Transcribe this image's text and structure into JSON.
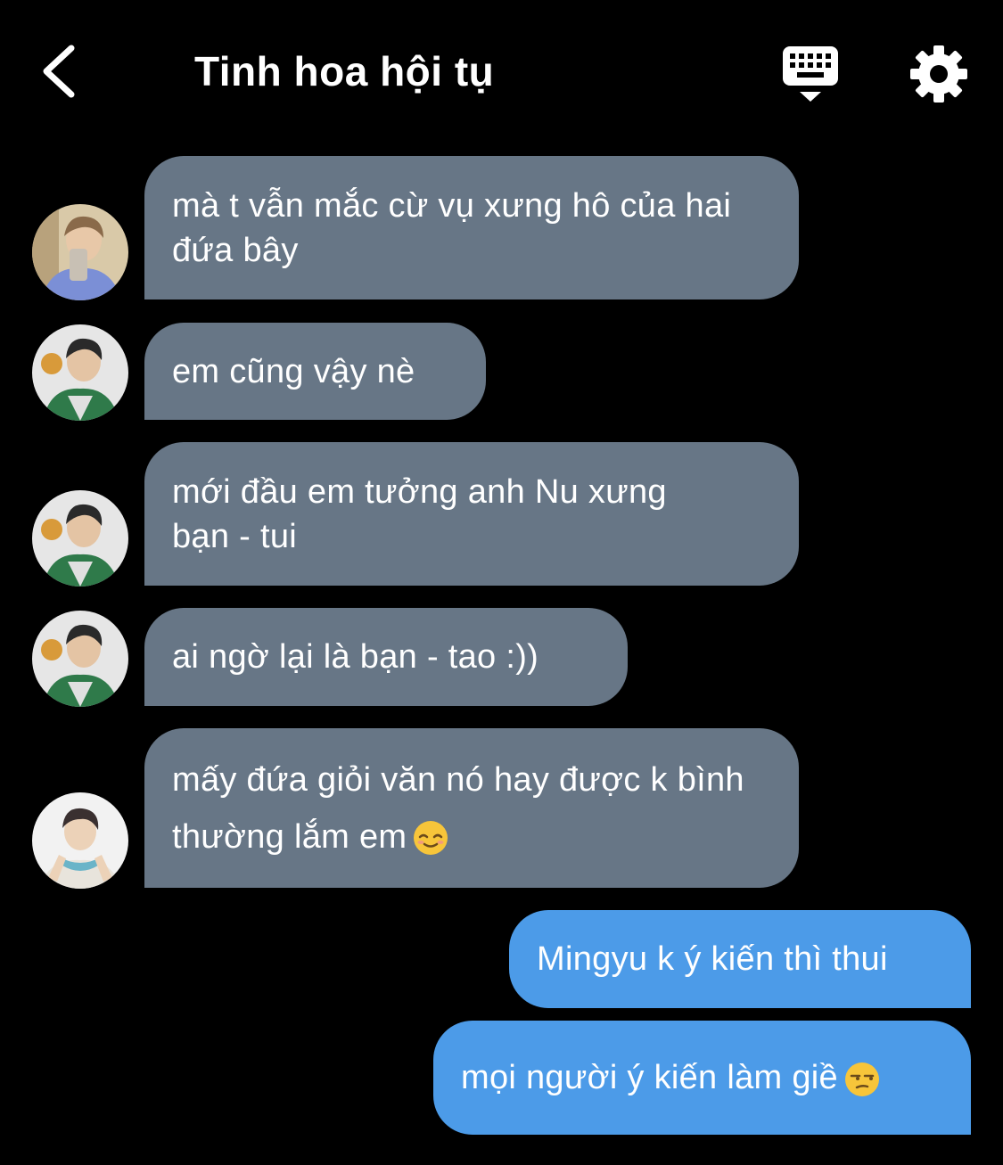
{
  "header": {
    "title": "Tinh hoa hội tụ",
    "back_icon": "chevron-left-icon",
    "keyboard_icon": "keyboard-hide-icon",
    "settings_icon": "gear-icon"
  },
  "colors": {
    "background": "#000000",
    "incoming_bubble": "#677686",
    "outgoing_bubble": "#4c9be8",
    "text": "#ffffff"
  },
  "messages": [
    {
      "direction": "incoming",
      "text": "mà t vẫn mắc cừ vụ xưng hô của hai đứa bây"
    },
    {
      "direction": "incoming",
      "text": "em cũng vậy nè"
    },
    {
      "direction": "incoming",
      "text": "mới đầu em tưởng anh Nu xưng bạn - tui"
    },
    {
      "direction": "incoming",
      "text": "ai ngờ lại là bạn - tao :))"
    },
    {
      "direction": "incoming",
      "text": "mấy đứa giỏi văn nó hay được k bình thường lắm em",
      "emoji": "relieved-face-emoji"
    },
    {
      "direction": "outgoing",
      "text": "Mingyu k ý kiến thì thui"
    },
    {
      "direction": "outgoing",
      "text": "mọi người ý kiến làm giề",
      "emoji": "unamused-face-emoji"
    }
  ]
}
